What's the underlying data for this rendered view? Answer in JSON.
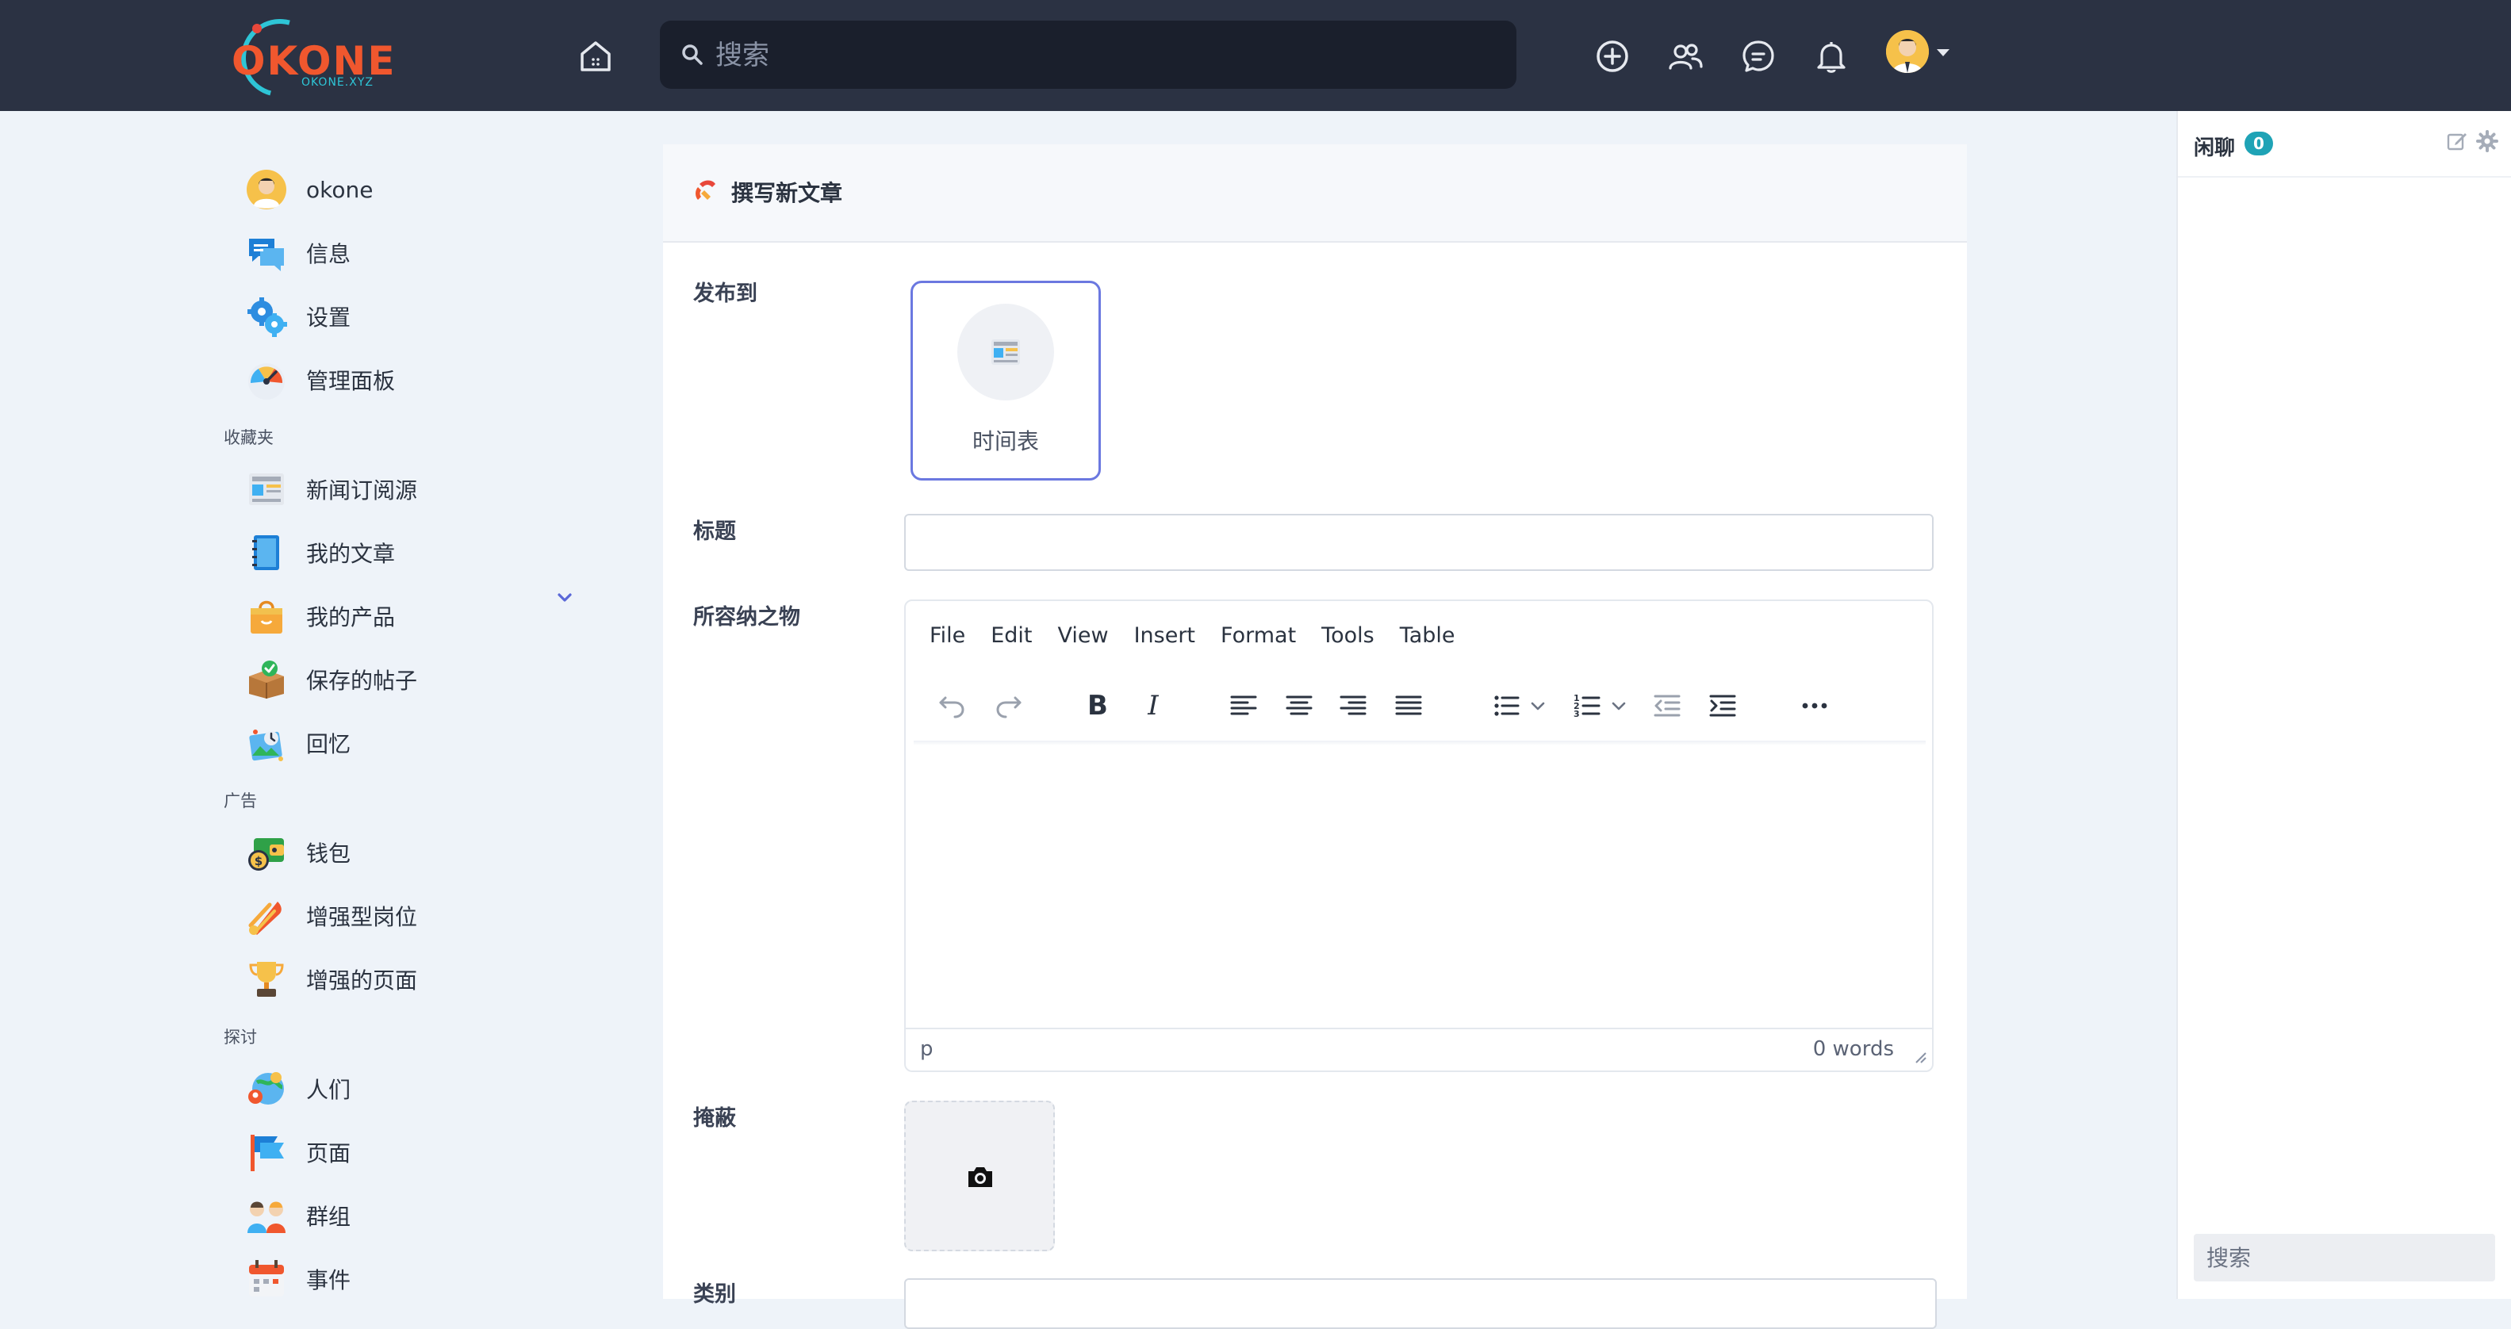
{
  "app": {
    "logo_text": "OKONE",
    "logo_sub": "OKONE.XYZ"
  },
  "topbar": {
    "search_placeholder": "搜索",
    "icons": [
      "home-icon",
      "search-icon",
      "plus-circle-icon",
      "users-icon",
      "chat-icon",
      "bell-icon",
      "avatar",
      "caret-down-icon"
    ]
  },
  "sidebar": {
    "user": {
      "label": "okone"
    },
    "main": [
      {
        "label": "信息",
        "icon": "messages-icon"
      },
      {
        "label": "设置",
        "icon": "settings-gear-icon"
      },
      {
        "label": "管理面板",
        "icon": "dashboard-gauge-icon"
      }
    ],
    "sections": {
      "favorites": "收藏夹",
      "ads": "广告",
      "explore": "探讨"
    },
    "favorites": [
      {
        "label": "新闻订阅源",
        "icon": "news-feed-icon"
      },
      {
        "label": "我的文章",
        "icon": "notebook-icon"
      },
      {
        "label": "我的产品",
        "icon": "shopping-bag-icon"
      },
      {
        "label": "保存的帖子",
        "icon": "saved-box-icon"
      },
      {
        "label": "回忆",
        "icon": "memories-icon"
      }
    ],
    "ads": [
      {
        "label": "钱包",
        "icon": "wallet-icon"
      },
      {
        "label": "增强型岗位",
        "icon": "boost-rocket-icon"
      },
      {
        "label": "增强的页面",
        "icon": "trophy-icon"
      }
    ],
    "explore": [
      {
        "label": "人们",
        "icon": "people-icon"
      },
      {
        "label": "页面",
        "icon": "flag-icon"
      },
      {
        "label": "群组",
        "icon": "group-icon"
      },
      {
        "label": "事件",
        "icon": "calendar-icon"
      }
    ]
  },
  "main": {
    "title": "撰写新文章",
    "labels": {
      "publish_to": "发布到",
      "title": "标题",
      "content": "所容纳之物",
      "cover": "掩蔽",
      "category": "类别"
    },
    "publish_target": "时间表",
    "title_value": "",
    "editor": {
      "menu": [
        "File",
        "Edit",
        "View",
        "Insert",
        "Format",
        "Tools",
        "Table"
      ],
      "status_path": "p",
      "word_count": "0 words"
    }
  },
  "chat": {
    "title": "闲聊",
    "count": "0",
    "search_placeholder": "搜索"
  },
  "colors": {
    "topbar": "#2b3243",
    "accent": "#6b78e0",
    "badge": "#1fa3b6",
    "logo": "#f0572e"
  }
}
